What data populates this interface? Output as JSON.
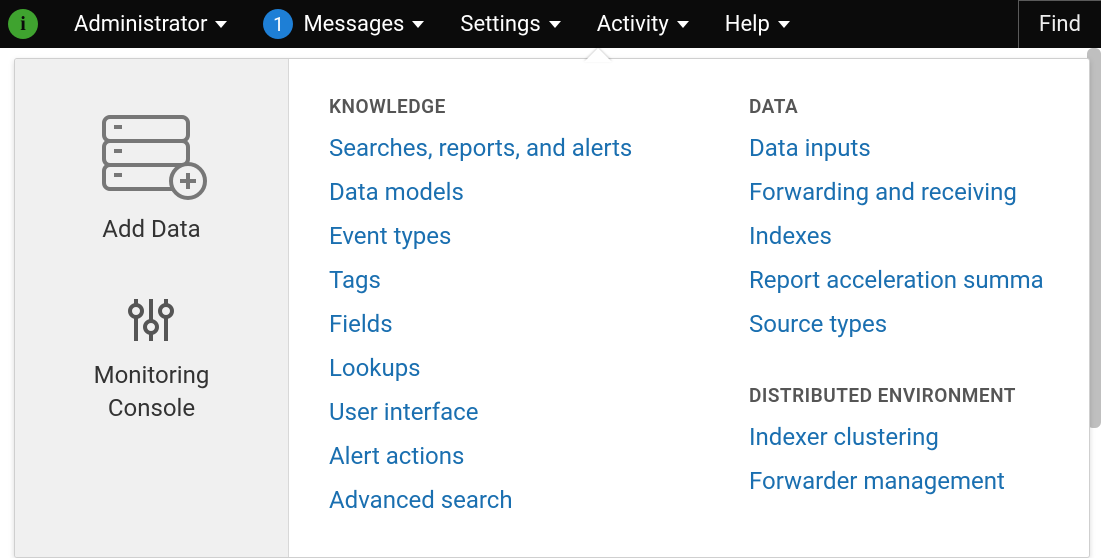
{
  "topbar": {
    "info_glyph": "i",
    "items": [
      {
        "id": "administrator",
        "label": "Administrator",
        "badge": null
      },
      {
        "id": "messages",
        "label": "Messages",
        "badge": "1"
      },
      {
        "id": "settings",
        "label": "Settings",
        "badge": null
      },
      {
        "id": "activity",
        "label": "Activity",
        "badge": null
      },
      {
        "id": "help",
        "label": "Help",
        "badge": null
      }
    ],
    "find_label": "Find"
  },
  "sidebar": {
    "add_data": "Add Data",
    "monitoring_console_l1": "Monitoring",
    "monitoring_console_l2": "Console"
  },
  "settings_menu": {
    "knowledge": {
      "heading": "KNOWLEDGE",
      "links": [
        "Searches, reports, and alerts",
        "Data models",
        "Event types",
        "Tags",
        "Fields",
        "Lookups",
        "User interface",
        "Alert actions",
        "Advanced search"
      ]
    },
    "data": {
      "heading": "DATA",
      "links": [
        "Data inputs",
        "Forwarding and receiving",
        "Indexes",
        "Report acceleration summa",
        "Source types"
      ]
    },
    "distributed": {
      "heading": "DISTRIBUTED ENVIRONMENT",
      "links": [
        "Indexer clustering",
        "Forwarder management"
      ]
    }
  }
}
